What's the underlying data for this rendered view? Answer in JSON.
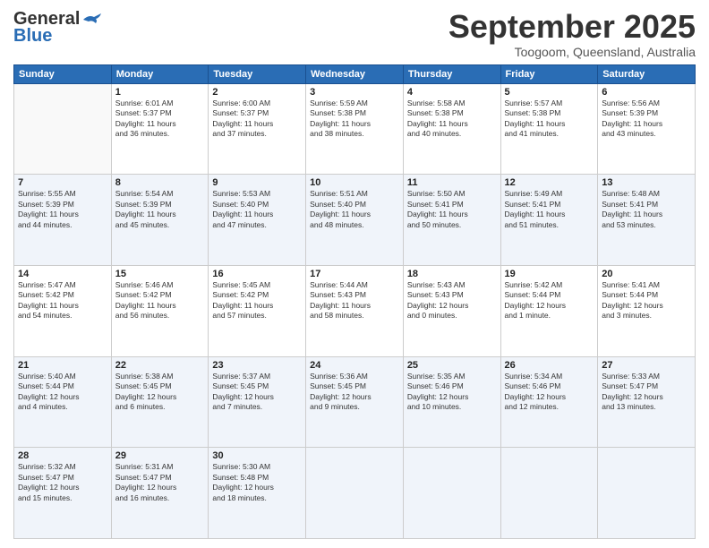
{
  "logo": {
    "line1": "General",
    "line2": "Blue"
  },
  "title": "September 2025",
  "subtitle": "Toogoom, Queensland, Australia",
  "weekdays": [
    "Sunday",
    "Monday",
    "Tuesday",
    "Wednesday",
    "Thursday",
    "Friday",
    "Saturday"
  ],
  "weeks": [
    [
      {
        "day": "",
        "info": ""
      },
      {
        "day": "1",
        "info": "Sunrise: 6:01 AM\nSunset: 5:37 PM\nDaylight: 11 hours\nand 36 minutes."
      },
      {
        "day": "2",
        "info": "Sunrise: 6:00 AM\nSunset: 5:37 PM\nDaylight: 11 hours\nand 37 minutes."
      },
      {
        "day": "3",
        "info": "Sunrise: 5:59 AM\nSunset: 5:38 PM\nDaylight: 11 hours\nand 38 minutes."
      },
      {
        "day": "4",
        "info": "Sunrise: 5:58 AM\nSunset: 5:38 PM\nDaylight: 11 hours\nand 40 minutes."
      },
      {
        "day": "5",
        "info": "Sunrise: 5:57 AM\nSunset: 5:38 PM\nDaylight: 11 hours\nand 41 minutes."
      },
      {
        "day": "6",
        "info": "Sunrise: 5:56 AM\nSunset: 5:39 PM\nDaylight: 11 hours\nand 43 minutes."
      }
    ],
    [
      {
        "day": "7",
        "info": "Sunrise: 5:55 AM\nSunset: 5:39 PM\nDaylight: 11 hours\nand 44 minutes."
      },
      {
        "day": "8",
        "info": "Sunrise: 5:54 AM\nSunset: 5:39 PM\nDaylight: 11 hours\nand 45 minutes."
      },
      {
        "day": "9",
        "info": "Sunrise: 5:53 AM\nSunset: 5:40 PM\nDaylight: 11 hours\nand 47 minutes."
      },
      {
        "day": "10",
        "info": "Sunrise: 5:51 AM\nSunset: 5:40 PM\nDaylight: 11 hours\nand 48 minutes."
      },
      {
        "day": "11",
        "info": "Sunrise: 5:50 AM\nSunset: 5:41 PM\nDaylight: 11 hours\nand 50 minutes."
      },
      {
        "day": "12",
        "info": "Sunrise: 5:49 AM\nSunset: 5:41 PM\nDaylight: 11 hours\nand 51 minutes."
      },
      {
        "day": "13",
        "info": "Sunrise: 5:48 AM\nSunset: 5:41 PM\nDaylight: 11 hours\nand 53 minutes."
      }
    ],
    [
      {
        "day": "14",
        "info": "Sunrise: 5:47 AM\nSunset: 5:42 PM\nDaylight: 11 hours\nand 54 minutes."
      },
      {
        "day": "15",
        "info": "Sunrise: 5:46 AM\nSunset: 5:42 PM\nDaylight: 11 hours\nand 56 minutes."
      },
      {
        "day": "16",
        "info": "Sunrise: 5:45 AM\nSunset: 5:42 PM\nDaylight: 11 hours\nand 57 minutes."
      },
      {
        "day": "17",
        "info": "Sunrise: 5:44 AM\nSunset: 5:43 PM\nDaylight: 11 hours\nand 58 minutes."
      },
      {
        "day": "18",
        "info": "Sunrise: 5:43 AM\nSunset: 5:43 PM\nDaylight: 12 hours\nand 0 minutes."
      },
      {
        "day": "19",
        "info": "Sunrise: 5:42 AM\nSunset: 5:44 PM\nDaylight: 12 hours\nand 1 minute."
      },
      {
        "day": "20",
        "info": "Sunrise: 5:41 AM\nSunset: 5:44 PM\nDaylight: 12 hours\nand 3 minutes."
      }
    ],
    [
      {
        "day": "21",
        "info": "Sunrise: 5:40 AM\nSunset: 5:44 PM\nDaylight: 12 hours\nand 4 minutes."
      },
      {
        "day": "22",
        "info": "Sunrise: 5:38 AM\nSunset: 5:45 PM\nDaylight: 12 hours\nand 6 minutes."
      },
      {
        "day": "23",
        "info": "Sunrise: 5:37 AM\nSunset: 5:45 PM\nDaylight: 12 hours\nand 7 minutes."
      },
      {
        "day": "24",
        "info": "Sunrise: 5:36 AM\nSunset: 5:45 PM\nDaylight: 12 hours\nand 9 minutes."
      },
      {
        "day": "25",
        "info": "Sunrise: 5:35 AM\nSunset: 5:46 PM\nDaylight: 12 hours\nand 10 minutes."
      },
      {
        "day": "26",
        "info": "Sunrise: 5:34 AM\nSunset: 5:46 PM\nDaylight: 12 hours\nand 12 minutes."
      },
      {
        "day": "27",
        "info": "Sunrise: 5:33 AM\nSunset: 5:47 PM\nDaylight: 12 hours\nand 13 minutes."
      }
    ],
    [
      {
        "day": "28",
        "info": "Sunrise: 5:32 AM\nSunset: 5:47 PM\nDaylight: 12 hours\nand 15 minutes."
      },
      {
        "day": "29",
        "info": "Sunrise: 5:31 AM\nSunset: 5:47 PM\nDaylight: 12 hours\nand 16 minutes."
      },
      {
        "day": "30",
        "info": "Sunrise: 5:30 AM\nSunset: 5:48 PM\nDaylight: 12 hours\nand 18 minutes."
      },
      {
        "day": "",
        "info": ""
      },
      {
        "day": "",
        "info": ""
      },
      {
        "day": "",
        "info": ""
      },
      {
        "day": "",
        "info": ""
      }
    ]
  ]
}
